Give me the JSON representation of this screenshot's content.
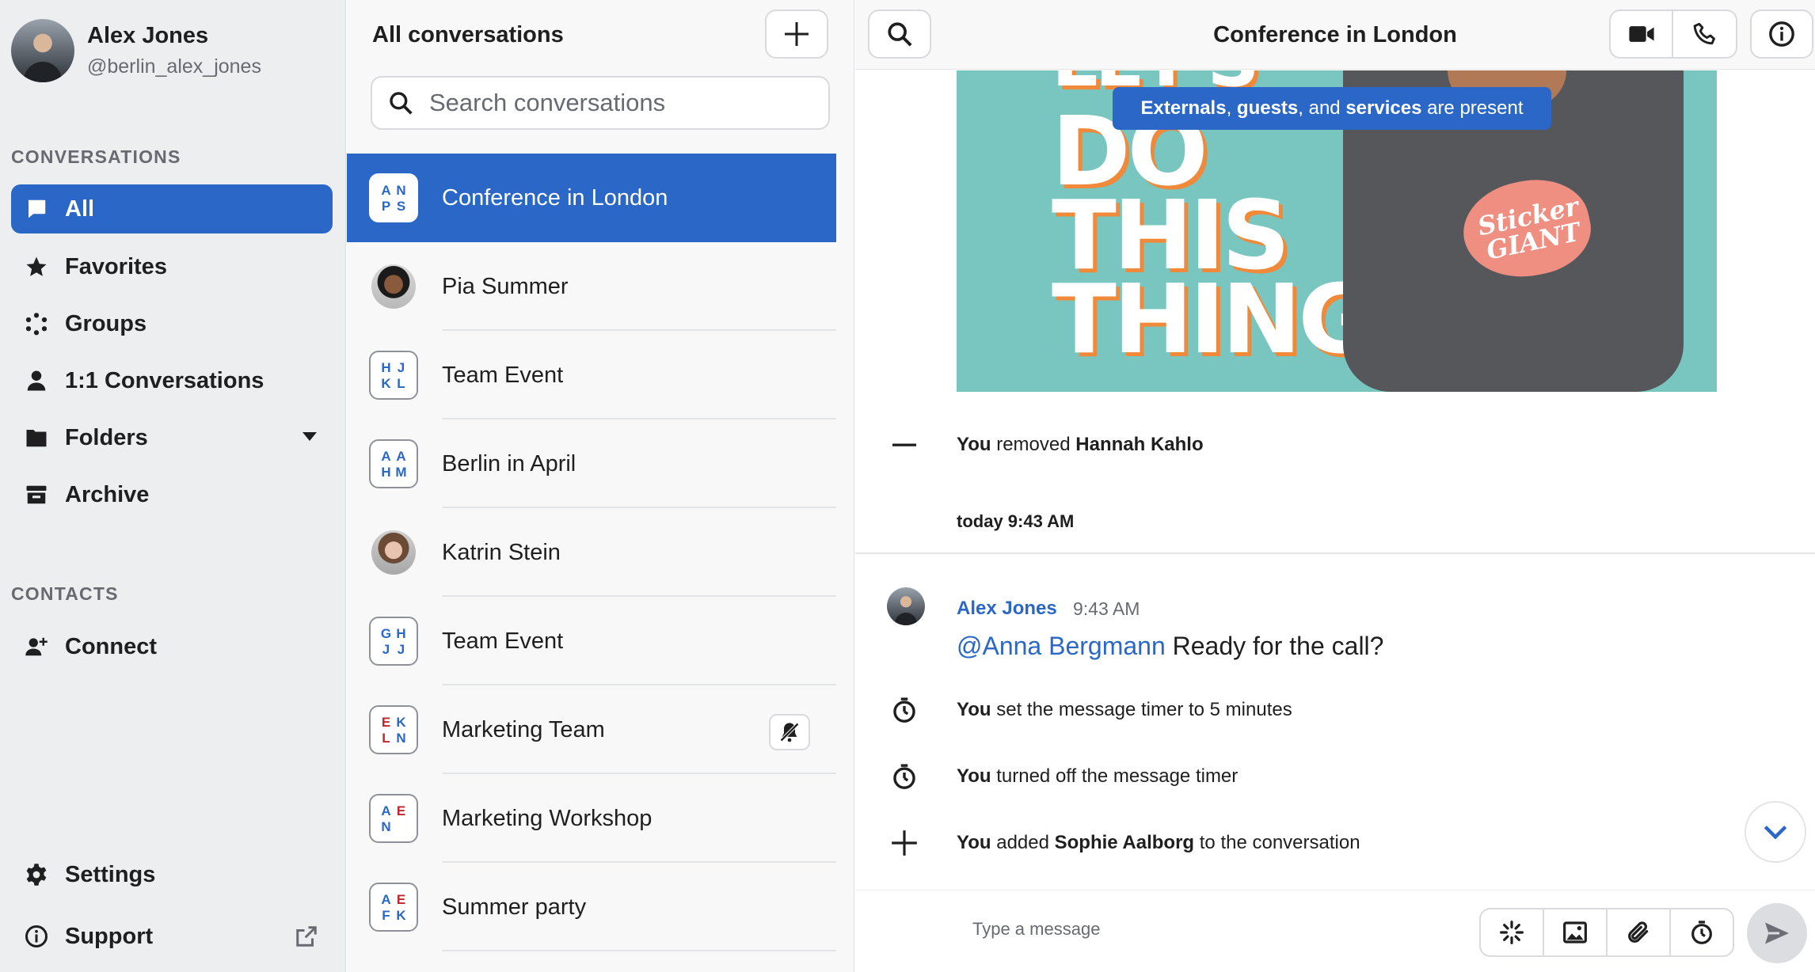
{
  "user": {
    "name": "Alex Jones",
    "handle": "@berlin_alex_jones"
  },
  "sidebar": {
    "conversations_label": "CONVERSATIONS",
    "items": [
      {
        "label": "All",
        "icon": "chat-bubble-icon"
      },
      {
        "label": "Favorites",
        "icon": "star-icon"
      },
      {
        "label": "Groups",
        "icon": "groups-icon"
      },
      {
        "label": "1:1 Conversations",
        "icon": "person-icon"
      },
      {
        "label": "Folders",
        "icon": "folder-icon"
      },
      {
        "label": "Archive",
        "icon": "archive-icon"
      }
    ],
    "contacts_label": "CONTACTS",
    "connect_label": "Connect",
    "settings_label": "Settings",
    "support_label": "Support"
  },
  "list": {
    "title": "All conversations",
    "search_placeholder": "Search conversations",
    "conversations": [
      {
        "name": "Conference in London",
        "type": "group",
        "letters": [
          "A",
          "N",
          "P",
          "S"
        ],
        "active": true
      },
      {
        "name": "Pia Summer",
        "type": "person"
      },
      {
        "name": "Team Event",
        "type": "group",
        "letters": [
          "H",
          "J",
          "K",
          "L"
        ]
      },
      {
        "name": "Berlin in April",
        "type": "group",
        "letters": [
          "A",
          "A",
          "H",
          "M"
        ]
      },
      {
        "name": "Katrin Stein",
        "type": "person"
      },
      {
        "name": "Team Event",
        "type": "group",
        "letters": [
          "G",
          "H",
          "J",
          "J"
        ]
      },
      {
        "name": "Marketing Team",
        "type": "group",
        "letters": [
          "E",
          "K",
          "L",
          "N"
        ],
        "muted": true
      },
      {
        "name": "Marketing Workshop",
        "type": "group",
        "letters": [
          "A",
          "E",
          "N",
          ""
        ]
      },
      {
        "name": "Summer party",
        "type": "group",
        "letters": [
          "A",
          "E",
          "F",
          "K"
        ]
      }
    ]
  },
  "chat": {
    "title": "Conference in London",
    "banner": {
      "w1": "Externals",
      "sep1": ",",
      "w2": "guests",
      "sep2": ", and",
      "w3": "services",
      "tail": "are present"
    },
    "gif_lines": [
      "LET'S",
      "DO",
      "THIS",
      "THING"
    ],
    "gif_logo": "Sticker GIANT",
    "removed": {
      "actor": "You",
      "verb": "removed",
      "target": "Hannah Kahlo"
    },
    "day_label": "today 9:43 AM",
    "message": {
      "author": "Alex Jones",
      "time": "9:43 AM",
      "mention": "@Anna Bergmann",
      "text": "Ready for the call?"
    },
    "timer_set": {
      "actor": "You",
      "text": "set the message timer to 5 minutes"
    },
    "timer_off": {
      "actor": "You",
      "text": "turned off the message timer"
    },
    "added": {
      "actor": "You",
      "verb": "added",
      "target": "Sophie Aalborg",
      "tail": "to the conversation"
    },
    "composer_placeholder": "Type a message"
  },
  "colors": {
    "accent": "#2a67c6",
    "sidebar_bg": "#edeef0",
    "list_bg": "#f8f8f8",
    "muted_text": "#676b71",
    "red_letter": "#c0272d",
    "blue_letter": "#2a67c6"
  }
}
